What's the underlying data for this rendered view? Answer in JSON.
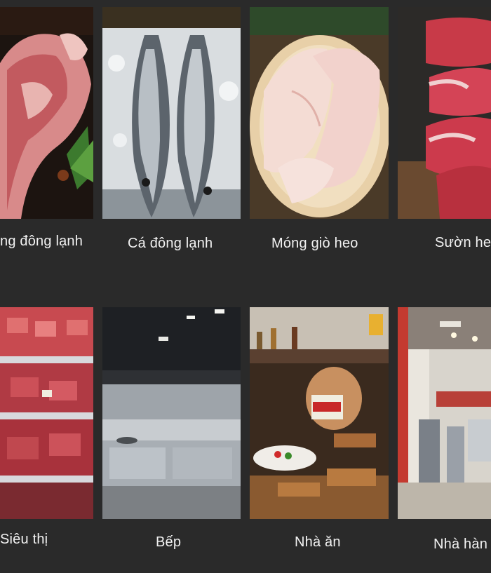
{
  "row1": {
    "captions": [
      "ng đông lạnh",
      "Cá đông lạnh",
      "Móng giò heo",
      "Sườn he"
    ],
    "images": [
      "frozen-bone-meat-image",
      "frozen-tuna-image",
      "pork-trotter-image",
      "lamb-ribs-image"
    ]
  },
  "row2": {
    "captions": [
      "Siêu thị",
      "Bếp",
      "Nhà ăn",
      "Nhà hàn"
    ],
    "images": [
      "supermarket-meat-counter-image",
      "commercial-kitchen-image",
      "buffet-canteen-image",
      "restaurant-store-image"
    ]
  },
  "colors": {
    "background": "#2a2a2a",
    "caption_text": "#f2f2f2"
  }
}
